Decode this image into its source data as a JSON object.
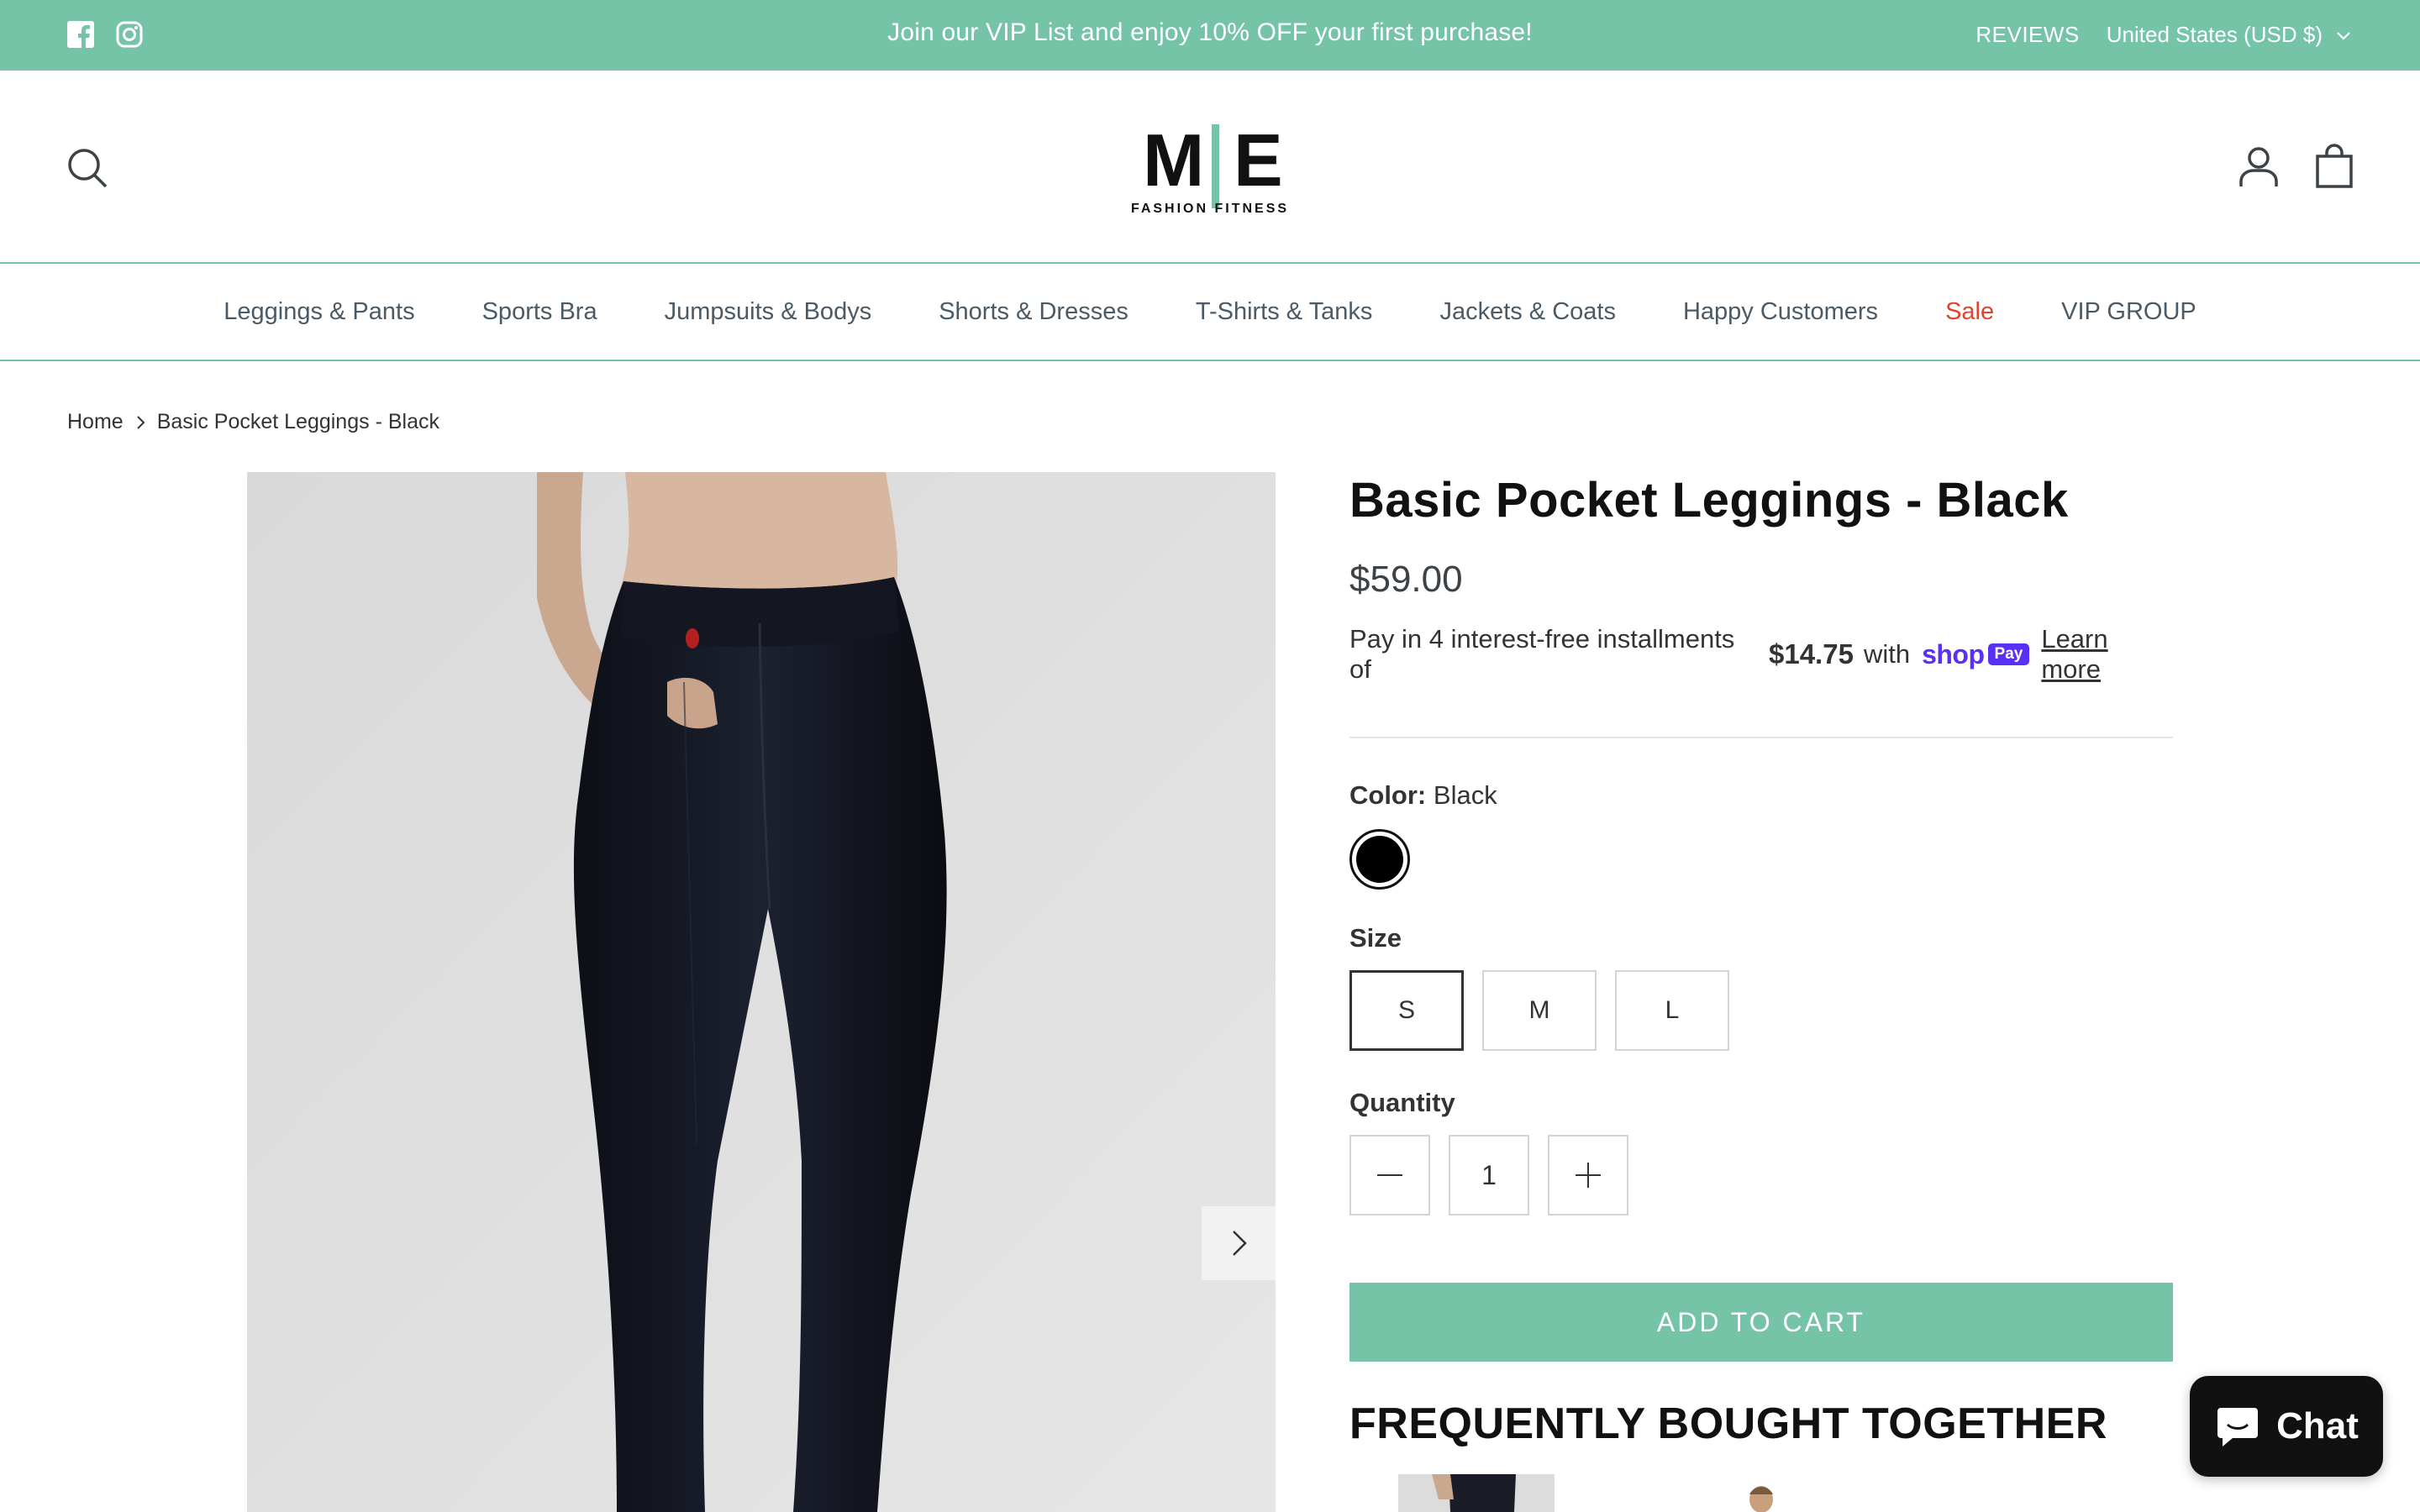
{
  "announcement": {
    "message": "Join our VIP List and enjoy 10% OFF your first purchase!",
    "reviews_label": "REVIEWS",
    "currency_label": "United States (USD $)"
  },
  "header": {
    "logo_letters_left": "M",
    "logo_letters_right": "E",
    "logo_subtitle": "FASHION FITNESS"
  },
  "nav": {
    "items": [
      {
        "label": "Leggings & Pants"
      },
      {
        "label": "Sports Bra"
      },
      {
        "label": "Jumpsuits & Bodys"
      },
      {
        "label": "Shorts & Dresses"
      },
      {
        "label": "T-Shirts & Tanks"
      },
      {
        "label": "Jackets & Coats"
      },
      {
        "label": "Happy Customers"
      },
      {
        "label": "Sale"
      },
      {
        "label": "VIP GROUP"
      }
    ]
  },
  "breadcrumb": {
    "home": "Home",
    "current": "Basic Pocket Leggings - Black"
  },
  "product": {
    "title": "Basic Pocket Leggings - Black",
    "price": "$59.00",
    "installments_prefix": "Pay in 4 interest-free installments of",
    "installment_amount": "$14.75",
    "installments_with": "with",
    "shoppay_shop": "shop",
    "shoppay_pay": "Pay",
    "learn_more": "Learn more",
    "color_label": "Color:",
    "color_value": "Black",
    "color_swatch": "#000000",
    "size_label": "Size",
    "sizes": [
      "S",
      "M",
      "L"
    ],
    "selected_size": "S",
    "quantity_label": "Quantity",
    "quantity": "1",
    "add_to_cart": "ADD TO CART",
    "fbt_heading": "FREQUENTLY BOUGHT TOGETHER"
  },
  "chat": {
    "label": "Chat"
  },
  "colors": {
    "accent": "#76c4a7",
    "sale": "#e0442b",
    "shoppay": "#5a31f4"
  }
}
